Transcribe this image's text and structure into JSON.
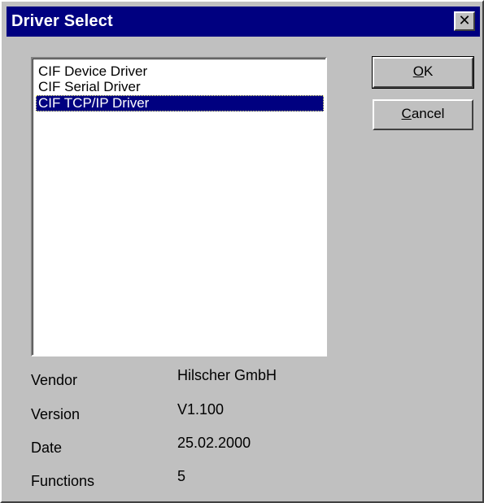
{
  "window": {
    "title": "Driver Select",
    "close_glyph": "✕",
    "close_icon": "close-icon"
  },
  "drivers": {
    "items": [
      {
        "label": "CIF Device Driver",
        "selected": false
      },
      {
        "label": "CIF Serial Driver",
        "selected": false
      },
      {
        "label": "CIF TCP/IP Driver",
        "selected": true
      }
    ]
  },
  "buttons": {
    "ok": {
      "mnemonic": "O",
      "rest": "K"
    },
    "cancel": {
      "mnemonic": "C",
      "rest": "ancel"
    }
  },
  "info": {
    "vendor_label": "Vendor",
    "vendor_value": "Hilscher GmbH",
    "version_label": "Version",
    "version_value": "V1.100",
    "date_label": "Date",
    "date_value": "25.02.2000",
    "functions_label": "Functions",
    "functions_value": "5"
  },
  "colors": {
    "titlebar": "#000080",
    "face": "#c0c0c0",
    "selection": "#000080"
  }
}
